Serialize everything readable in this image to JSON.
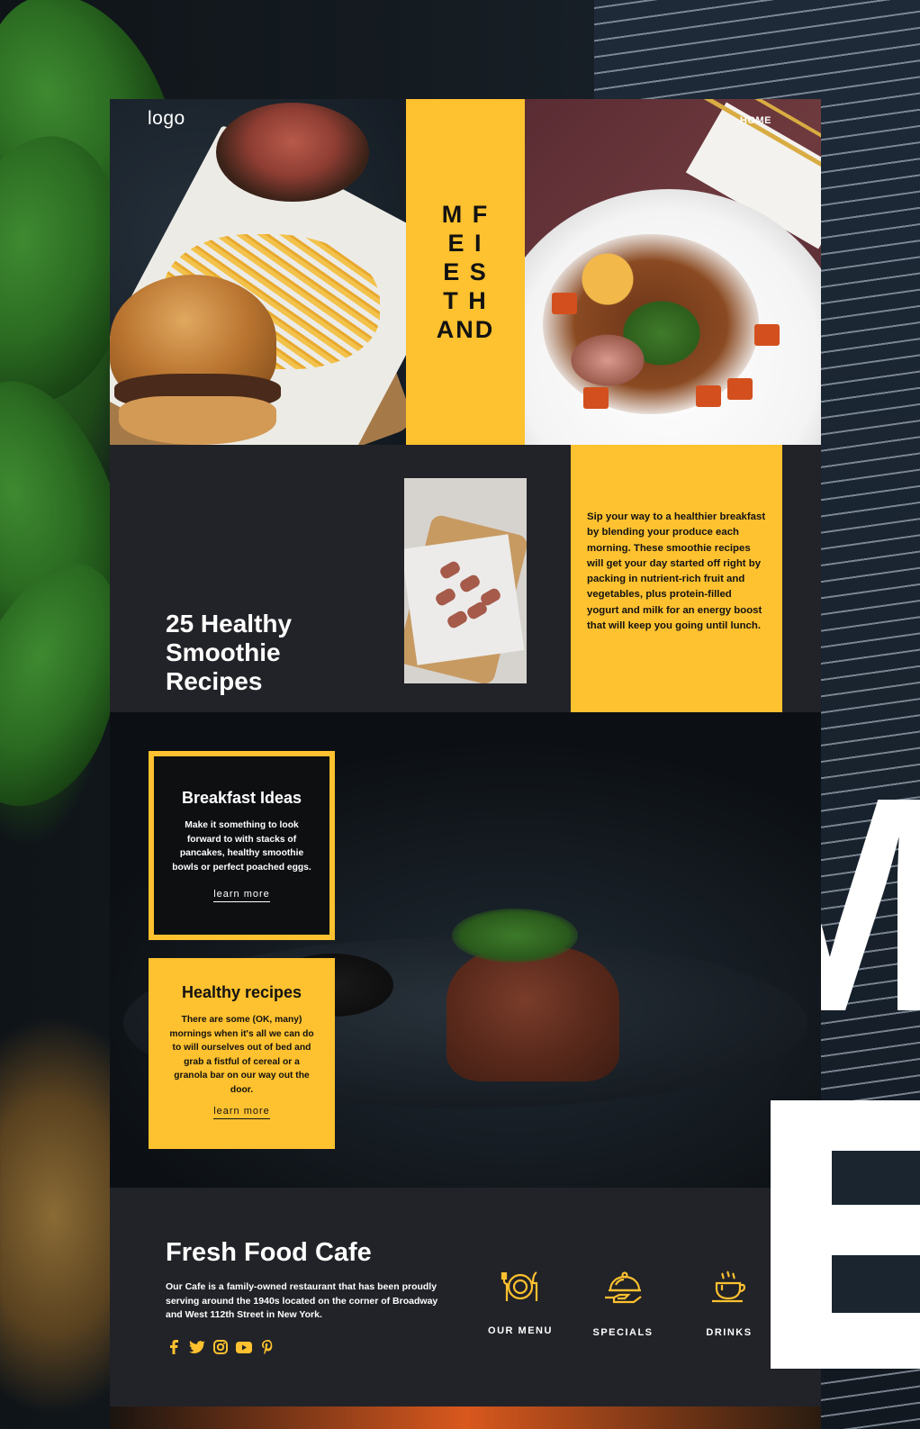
{
  "header": {
    "logo_text": "logo",
    "nav_home": "HOME",
    "vertical_title_lines": [
      "M F",
      "E I",
      "E S",
      "T H",
      "AND"
    ]
  },
  "intro": {
    "title_line1": "25 Healthy",
    "title_line2": "Smoothie",
    "title_line3": "Recipes",
    "description": "Sip your way to a healthier breakfast by blending your produce each morning. These smoothie recipes will get your day started off right by packing in nutrient-rich fruit and vegetables, plus protein-filled yogurt and milk for an energy boost that will keep you going until lunch."
  },
  "cards": [
    {
      "title": "Breakfast Ideas",
      "text": "Make it something to look forward to with stacks of pancakes, healthy smoothie bowls or perfect poached eggs.",
      "link": "learn more"
    },
    {
      "title": "Healthy recipes",
      "text": "There are some (OK, many) mornings when it's all we can do to will ourselves out of bed and grab a fistful of cereal or a granola bar on our way out the door.",
      "link": "learn more"
    }
  ],
  "footer": {
    "title": "Fresh Food Cafe",
    "about": "Our Cafe is a family-owned restaurant that has been proudly serving around the 1940s located on the corner of Broadway and West 112th Street in New York.",
    "social_icons": [
      "facebook-icon",
      "twitter-icon",
      "instagram-icon",
      "youtube-icon",
      "pinterest-icon"
    ],
    "services": [
      {
        "label": "OUR MENU",
        "icon": "menu-plate-icon"
      },
      {
        "label": "SPECIALS",
        "icon": "cloche-icon"
      },
      {
        "label": "DRINKS",
        "icon": "coffee-cup-icon"
      }
    ]
  },
  "decor": {
    "big_letter_1": "M",
    "big_letter_2": "E"
  },
  "colors": {
    "accent": "#fec12f",
    "dark": "#222328",
    "text_light": "#ffffff",
    "text_dark": "#121212"
  }
}
